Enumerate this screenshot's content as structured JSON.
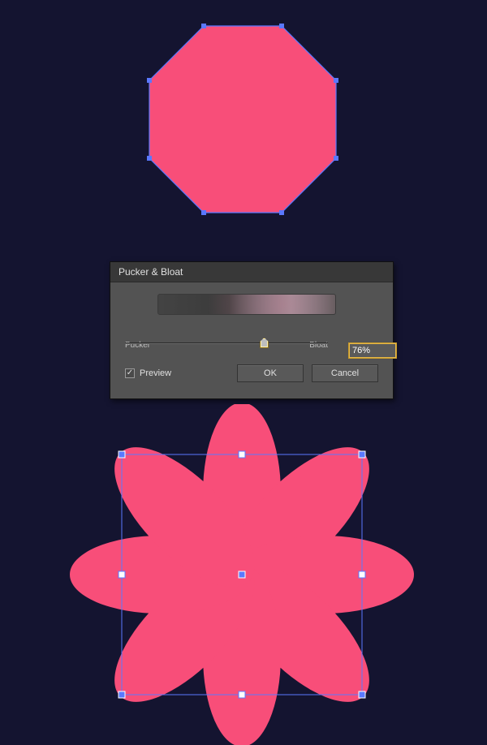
{
  "canvas": {
    "background": "#141430",
    "shape_fill": "#f84e79",
    "selection_color": "#5a78ff"
  },
  "dialog": {
    "title": "Pucker & Bloat",
    "slider": {
      "left_label": "Pucker",
      "right_label": "Bloat",
      "value_display": "76%",
      "value": 76,
      "min": -200,
      "max": 200
    },
    "preview_label": "Preview",
    "preview_checked": true,
    "ok_label": "OK",
    "cancel_label": "Cancel"
  }
}
